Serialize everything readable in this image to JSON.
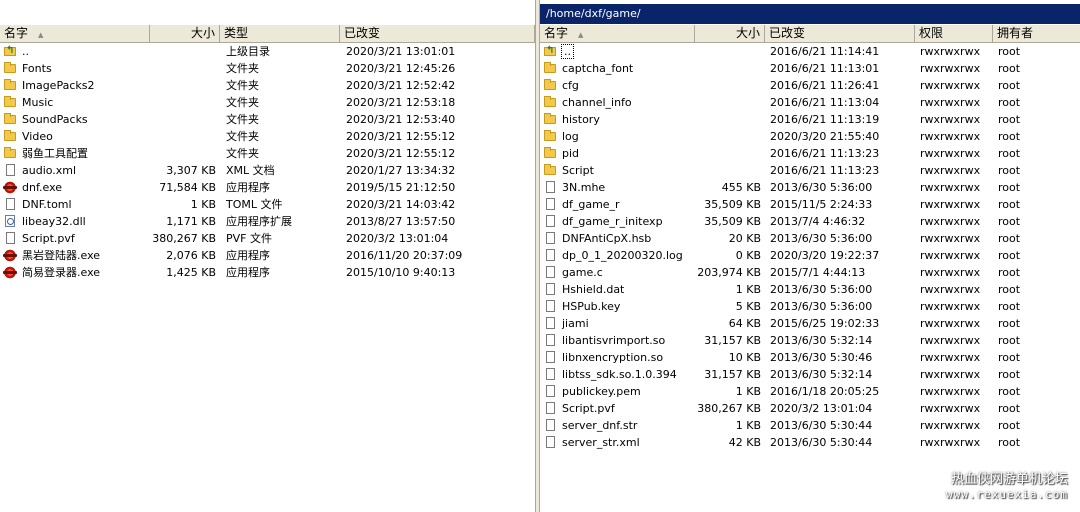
{
  "left": {
    "headers": {
      "name": "名字",
      "size": "大小",
      "type": "类型",
      "modified": "已改变"
    },
    "rows": [
      {
        "icon": "up-icon",
        "name": "..",
        "size": "",
        "type": "上级目录",
        "modified": "2020/3/21  13:01:01"
      },
      {
        "icon": "folder-icon",
        "name": "Fonts",
        "size": "",
        "type": "文件夹",
        "modified": "2020/3/21  12:45:26"
      },
      {
        "icon": "folder-icon",
        "name": "ImagePacks2",
        "size": "",
        "type": "文件夹",
        "modified": "2020/3/21  12:52:42"
      },
      {
        "icon": "folder-icon",
        "name": "Music",
        "size": "",
        "type": "文件夹",
        "modified": "2020/3/21  12:53:18"
      },
      {
        "icon": "folder-icon",
        "name": "SoundPacks",
        "size": "",
        "type": "文件夹",
        "modified": "2020/3/21  12:53:40"
      },
      {
        "icon": "folder-icon",
        "name": "Video",
        "size": "",
        "type": "文件夹",
        "modified": "2020/3/21  12:55:12"
      },
      {
        "icon": "folder-icon",
        "name": "弱鱼工具配置",
        "size": "",
        "type": "文件夹",
        "modified": "2020/3/21  12:55:12"
      },
      {
        "icon": "file-icon",
        "name": "audio.xml",
        "size": "3,307 KB",
        "type": "XML 文档",
        "modified": "2020/1/27  13:34:32"
      },
      {
        "icon": "exe-icon",
        "name": "dnf.exe",
        "size": "71,584 KB",
        "type": "应用程序",
        "modified": "2019/5/15  21:12:50"
      },
      {
        "icon": "file-icon",
        "name": "DNF.toml",
        "size": "1 KB",
        "type": "TOML 文件",
        "modified": "2020/3/21  14:03:42"
      },
      {
        "icon": "dll-icon",
        "name": "libeay32.dll",
        "size": "1,171 KB",
        "type": "应用程序扩展",
        "modified": "2013/8/27  13:57:50"
      },
      {
        "icon": "file-icon",
        "name": "Script.pvf",
        "size": "380,267 KB",
        "type": "PVF 文件",
        "modified": "2020/3/2  13:01:04"
      },
      {
        "icon": "exe-icon",
        "name": "黑岩登陆器.exe",
        "size": "2,076 KB",
        "type": "应用程序",
        "modified": "2016/11/20  20:37:09"
      },
      {
        "icon": "exe-icon",
        "name": "简易登录器.exe",
        "size": "1,425 KB",
        "type": "应用程序",
        "modified": "2015/10/10  9:40:13"
      }
    ]
  },
  "right": {
    "path": "/home/dxf/game/",
    "headers": {
      "name": "名字",
      "size": "大小",
      "modified": "已改变",
      "perms": "权限",
      "owner": "拥有者"
    },
    "rows": [
      {
        "icon": "up-icon",
        "name": "..",
        "size": "",
        "modified": "2016/6/21 11:14:41",
        "perms": "rwxrwxrwx",
        "owner": "root"
      },
      {
        "icon": "folder-icon",
        "name": "captcha_font",
        "size": "",
        "modified": "2016/6/21 11:13:01",
        "perms": "rwxrwxrwx",
        "owner": "root"
      },
      {
        "icon": "folder-icon",
        "name": "cfg",
        "size": "",
        "modified": "2016/6/21 11:26:41",
        "perms": "rwxrwxrwx",
        "owner": "root"
      },
      {
        "icon": "folder-icon",
        "name": "channel_info",
        "size": "",
        "modified": "2016/6/21 11:13:04",
        "perms": "rwxrwxrwx",
        "owner": "root"
      },
      {
        "icon": "folder-icon",
        "name": "history",
        "size": "",
        "modified": "2016/6/21 11:13:19",
        "perms": "rwxrwxrwx",
        "owner": "root"
      },
      {
        "icon": "folder-icon",
        "name": "log",
        "size": "",
        "modified": "2020/3/20 21:55:40",
        "perms": "rwxrwxrwx",
        "owner": "root"
      },
      {
        "icon": "folder-icon",
        "name": "pid",
        "size": "",
        "modified": "2016/6/21 11:13:23",
        "perms": "rwxrwxrwx",
        "owner": "root"
      },
      {
        "icon": "folder-icon",
        "name": "Script",
        "size": "",
        "modified": "2016/6/21 11:13:23",
        "perms": "rwxrwxrwx",
        "owner": "root"
      },
      {
        "icon": "file-icon",
        "name": "3N.mhe",
        "size": "455 KB",
        "modified": "2013/6/30 5:36:00",
        "perms": "rwxrwxrwx",
        "owner": "root"
      },
      {
        "icon": "file-icon",
        "name": "df_game_r",
        "size": "35,509 KB",
        "modified": "2015/11/5 2:24:33",
        "perms": "rwxrwxrwx",
        "owner": "root"
      },
      {
        "icon": "file-icon",
        "name": "df_game_r_initexp",
        "size": "35,509 KB",
        "modified": "2013/7/4 4:46:32",
        "perms": "rwxrwxrwx",
        "owner": "root"
      },
      {
        "icon": "file-icon",
        "name": "DNFAntiCpX.hsb",
        "size": "20 KB",
        "modified": "2013/6/30 5:36:00",
        "perms": "rwxrwxrwx",
        "owner": "root"
      },
      {
        "icon": "file-icon",
        "name": "dp_0_1_20200320.log",
        "size": "0 KB",
        "modified": "2020/3/20 19:22:37",
        "perms": "rwxrwxrwx",
        "owner": "root"
      },
      {
        "icon": "file-icon",
        "name": "game.c",
        "size": "203,974 KB",
        "modified": "2015/7/1 4:44:13",
        "perms": "rwxrwxrwx",
        "owner": "root"
      },
      {
        "icon": "file-icon",
        "name": "Hshield.dat",
        "size": "1 KB",
        "modified": "2013/6/30 5:36:00",
        "perms": "rwxrwxrwx",
        "owner": "root"
      },
      {
        "icon": "file-icon",
        "name": "HSPub.key",
        "size": "5 KB",
        "modified": "2013/6/30 5:36:00",
        "perms": "rwxrwxrwx",
        "owner": "root"
      },
      {
        "icon": "file-icon",
        "name": "jiami",
        "size": "64 KB",
        "modified": "2015/6/25 19:02:33",
        "perms": "rwxrwxrwx",
        "owner": "root"
      },
      {
        "icon": "file-icon",
        "name": "libantisvrimport.so",
        "size": "31,157 KB",
        "modified": "2013/6/30 5:32:14",
        "perms": "rwxrwxrwx",
        "owner": "root"
      },
      {
        "icon": "file-icon",
        "name": "libnxencryption.so",
        "size": "10 KB",
        "modified": "2013/6/30 5:30:46",
        "perms": "rwxrwxrwx",
        "owner": "root"
      },
      {
        "icon": "file-icon",
        "name": "libtss_sdk.so.1.0.394",
        "size": "31,157 KB",
        "modified": "2013/6/30 5:32:14",
        "perms": "rwxrwxrwx",
        "owner": "root"
      },
      {
        "icon": "file-icon",
        "name": "publickey.pem",
        "size": "1 KB",
        "modified": "2016/1/18 20:05:25",
        "perms": "rwxrwxrwx",
        "owner": "root"
      },
      {
        "icon": "file-icon",
        "name": "Script.pvf",
        "size": "380,267 KB",
        "modified": "2020/3/2 13:01:04",
        "perms": "rwxrwxrwx",
        "owner": "root"
      },
      {
        "icon": "file-icon",
        "name": "server_dnf.str",
        "size": "1 KB",
        "modified": "2013/6/30 5:30:44",
        "perms": "rwxrwxrwx",
        "owner": "root"
      },
      {
        "icon": "file-icon",
        "name": "server_str.xml",
        "size": "42 KB",
        "modified": "2013/6/30 5:30:44",
        "perms": "rwxrwxrwx",
        "owner": "root"
      }
    ]
  },
  "watermark": {
    "line1": "热血侠网游单机论坛",
    "line2": "www.rexuexia.com"
  }
}
